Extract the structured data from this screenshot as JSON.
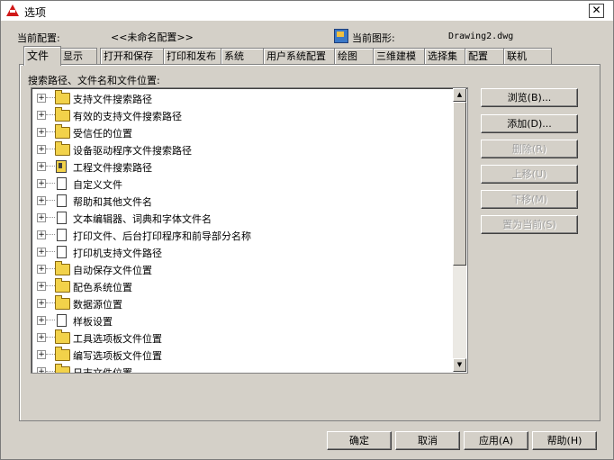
{
  "window": {
    "title": "选项",
    "close_glyph": "✕"
  },
  "profile": {
    "label": "当前配置:",
    "value": "<<未命名配置>>",
    "drawing_label": "当前图形:",
    "drawing_value": "Drawing2.dwg"
  },
  "tabs": [
    {
      "label": "文件",
      "active": true
    },
    {
      "label": "显示"
    },
    {
      "label": "打开和保存"
    },
    {
      "label": "打印和发布"
    },
    {
      "label": "系统"
    },
    {
      "label": "用户系统配置"
    },
    {
      "label": "绘图"
    },
    {
      "label": "三维建模"
    },
    {
      "label": "选择集"
    },
    {
      "label": "配置"
    },
    {
      "label": "联机"
    }
  ],
  "files_panel": {
    "heading": "搜索路径、文件名和文件位置:",
    "items": [
      {
        "label": "支持文件搜索路径",
        "icon": "folder-icon"
      },
      {
        "label": "有效的支持文件搜索路径",
        "icon": "folder-icon"
      },
      {
        "label": "受信任的位置",
        "icon": "folder-icon"
      },
      {
        "label": "设备驱动程序文件搜索路径",
        "icon": "folder-icon"
      },
      {
        "label": "工程文件搜索路径",
        "icon": "project-icon"
      },
      {
        "label": "自定义文件",
        "icon": "document-icon"
      },
      {
        "label": "帮助和其他文件名",
        "icon": "document-icon"
      },
      {
        "label": "文本编辑器、词典和字体文件名",
        "icon": "document-icon"
      },
      {
        "label": "打印文件、后台打印程序和前导部分名称",
        "icon": "document-icon"
      },
      {
        "label": "打印机支持文件路径",
        "icon": "document-icon"
      },
      {
        "label": "自动保存文件位置",
        "icon": "folder-icon"
      },
      {
        "label": "配色系统位置",
        "icon": "folder-icon"
      },
      {
        "label": "数据源位置",
        "icon": "folder-icon"
      },
      {
        "label": "样板设置",
        "icon": "document-icon"
      },
      {
        "label": "工具选项板文件位置",
        "icon": "folder-icon"
      },
      {
        "label": "编写选项板文件位置",
        "icon": "folder-icon"
      },
      {
        "label": "日志文件位置",
        "icon": "folder-icon"
      }
    ],
    "expander_glyph": "+"
  },
  "side_buttons": {
    "browse": "浏览(B)...",
    "add": "添加(D)...",
    "remove": "删除(R)",
    "move_up": "上移(U)",
    "move_down": "下移(M)",
    "set_current": "置为当前(S)"
  },
  "bottom_buttons": {
    "ok": "确定",
    "cancel": "取消",
    "apply": "应用(A)",
    "help": "帮助(H)"
  },
  "scroll": {
    "up_glyph": "▲",
    "down_glyph": "▼"
  }
}
